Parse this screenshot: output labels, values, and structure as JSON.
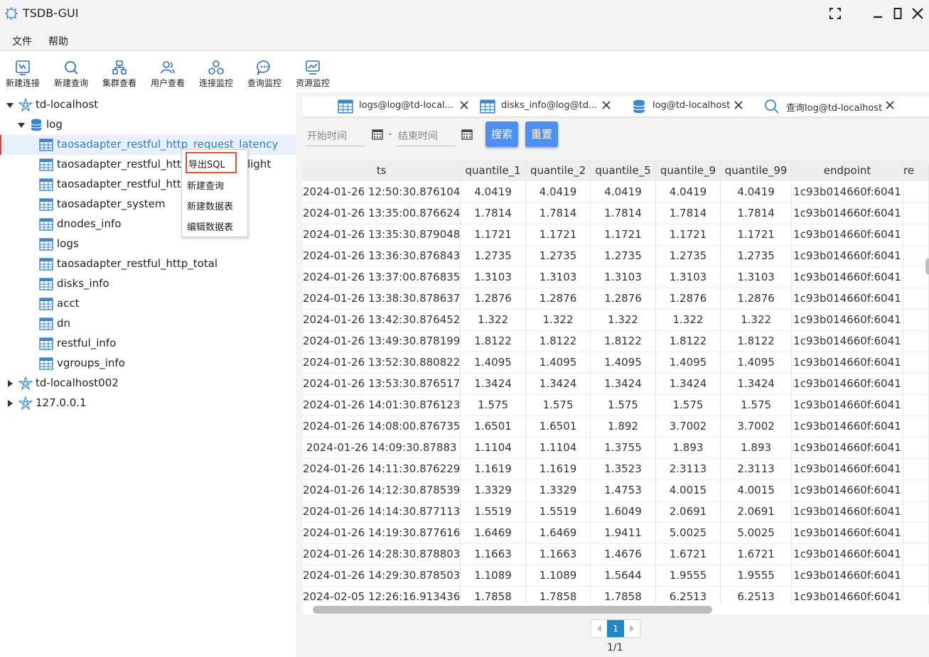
{
  "app": {
    "title": "TSDB-GUI"
  },
  "menu": {
    "file": "文件",
    "help": "帮助"
  },
  "toolbar": [
    {
      "label": "新建连接",
      "icon": "new-connection-icon"
    },
    {
      "label": "新建查询",
      "icon": "search-icon"
    },
    {
      "label": "集群查看",
      "icon": "cluster-icon"
    },
    {
      "label": "用户查看",
      "icon": "users-icon"
    },
    {
      "label": "连接监控",
      "icon": "connection-monitor-icon"
    },
    {
      "label": "查询监控",
      "icon": "chat-icon"
    },
    {
      "label": "资源监控",
      "icon": "monitor-chart-icon"
    }
  ],
  "tree": {
    "connection1": "td-localhost",
    "database": "log",
    "tables": [
      "taosadapter_restful_http_request_latency",
      "taosadapter_restful_http_request_fail",
      "taosadapter_restful_http_request_in_flight",
      "taosadapter_system",
      "dnodes_info",
      "logs",
      "taosadapter_restful_http_total",
      "disks_info",
      "acct",
      "dn",
      "restful_info",
      "vgroups_info"
    ],
    "visible_labels": [
      "taosadapter_restful_http_request_latency",
      "taosadapter_restful_http",
      "taosadapter_restful_http",
      "taosadapter_system",
      "dnodes_info",
      "logs",
      "taosadapter_restful_http_total",
      "disks_info",
      "acct",
      "dn",
      "restful_info",
      "vgroups_info"
    ],
    "flight_suffix": "light",
    "connection2": "td-localhost002",
    "connection3": "127.0.0.1"
  },
  "context_menu": {
    "export_sql": "导出SQL",
    "new_query": "新建查询",
    "new_table": "新建数据表",
    "edit_table": "编辑数据表"
  },
  "tabs": [
    {
      "label": "logs@log@td-local...",
      "icon": "table-icon"
    },
    {
      "label": "disks_info@log@td...",
      "icon": "table-icon"
    },
    {
      "label": "log@td-localhost",
      "icon": "database-icon"
    },
    {
      "label": "查询log@td-localhost",
      "icon": "search-icon"
    }
  ],
  "filters": {
    "start_placeholder": "开始时间",
    "separator": "-",
    "end_placeholder": "结束时间",
    "search_button": "搜索",
    "reset_button": "重置"
  },
  "table": {
    "columns": [
      "ts",
      "quantile_1",
      "quantile_2",
      "quantile_5",
      "quantile_9",
      "quantile_99",
      "endpoint",
      "re"
    ],
    "rows": [
      [
        "2024-01-26 12:50:30.876104",
        "4.0419",
        "4.0419",
        "4.0419",
        "4.0419",
        "4.0419",
        "1c93b014660f:6041"
      ],
      [
        "2024-01-26 13:35:00.876624",
        "1.7814",
        "1.7814",
        "1.7814",
        "1.7814",
        "1.7814",
        "1c93b014660f:6041"
      ],
      [
        "2024-01-26 13:35:30.879048",
        "1.1721",
        "1.1721",
        "1.1721",
        "1.1721",
        "1.1721",
        "1c93b014660f:6041"
      ],
      [
        "2024-01-26 13:36:30.876843",
        "1.2735",
        "1.2735",
        "1.2735",
        "1.2735",
        "1.2735",
        "1c93b014660f:6041"
      ],
      [
        "2024-01-26 13:37:00.876835",
        "1.3103",
        "1.3103",
        "1.3103",
        "1.3103",
        "1.3103",
        "1c93b014660f:6041"
      ],
      [
        "2024-01-26 13:38:30.878637",
        "1.2876",
        "1.2876",
        "1.2876",
        "1.2876",
        "1.2876",
        "1c93b014660f:6041"
      ],
      [
        "2024-01-26 13:42:30.876452",
        "1.322",
        "1.322",
        "1.322",
        "1.322",
        "1.322",
        "1c93b014660f:6041"
      ],
      [
        "2024-01-26 13:49:30.878199",
        "1.8122",
        "1.8122",
        "1.8122",
        "1.8122",
        "1.8122",
        "1c93b014660f:6041"
      ],
      [
        "2024-01-26 13:52:30.880822",
        "1.4095",
        "1.4095",
        "1.4095",
        "1.4095",
        "1.4095",
        "1c93b014660f:6041"
      ],
      [
        "2024-01-26 13:53:30.876517",
        "1.3424",
        "1.3424",
        "1.3424",
        "1.3424",
        "1.3424",
        "1c93b014660f:6041"
      ],
      [
        "2024-01-26 14:01:30.876123",
        "1.575",
        "1.575",
        "1.575",
        "1.575",
        "1.575",
        "1c93b014660f:6041"
      ],
      [
        "2024-01-26 14:08:00.876735",
        "1.6501",
        "1.6501",
        "1.892",
        "3.7002",
        "3.7002",
        "1c93b014660f:6041"
      ],
      [
        "2024-01-26 14:09:30.87883",
        "1.1104",
        "1.1104",
        "1.3755",
        "1.893",
        "1.893",
        "1c93b014660f:6041"
      ],
      [
        "2024-01-26 14:11:30.876229",
        "1.1619",
        "1.1619",
        "1.3523",
        "2.3113",
        "2.3113",
        "1c93b014660f:6041"
      ],
      [
        "2024-01-26 14:12:30.878539",
        "1.3329",
        "1.3329",
        "1.4753",
        "4.0015",
        "4.0015",
        "1c93b014660f:6041"
      ],
      [
        "2024-01-26 14:14:30.877113",
        "1.5519",
        "1.5519",
        "1.6049",
        "2.0691",
        "2.0691",
        "1c93b014660f:6041"
      ],
      [
        "2024-01-26 14:19:30.877616",
        "1.6469",
        "1.6469",
        "1.9411",
        "5.0025",
        "5.0025",
        "1c93b014660f:6041"
      ],
      [
        "2024-01-26 14:28:30.878803",
        "1.1663",
        "1.1663",
        "1.4676",
        "1.6721",
        "1.6721",
        "1c93b014660f:6041"
      ],
      [
        "2024-01-26 14:29:30.878503",
        "1.1089",
        "1.1089",
        "1.5644",
        "1.9555",
        "1.9555",
        "1c93b014660f:6041"
      ],
      [
        "2024-02-05 12:26:16.913436",
        "1.7858",
        "1.7858",
        "1.7858",
        "6.2513",
        "6.2513",
        "1c93b014660f:6041"
      ]
    ]
  },
  "pagination": {
    "current": "1",
    "info": "1/1"
  },
  "colors": {
    "accent": "#4d8ff2",
    "selected_text": "#2f7ad6",
    "pager_active": "#1e88c8",
    "context_highlight": "#e0532f"
  }
}
